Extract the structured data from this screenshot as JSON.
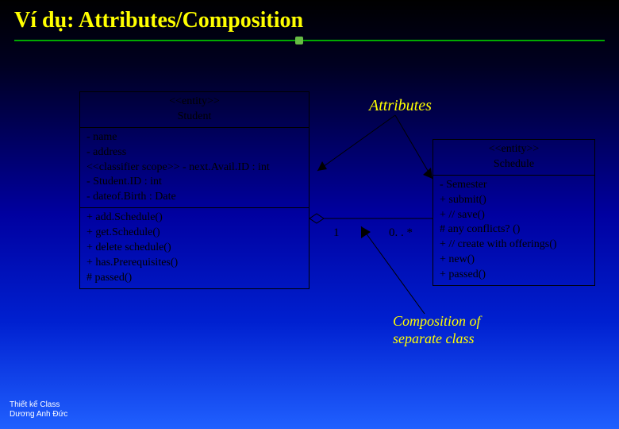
{
  "title": "Ví dụ: Attributes/Composition",
  "labels": {
    "attributes": "Attributes",
    "composition": "Composition of\nseparate class"
  },
  "student": {
    "stereotype": "<<entity>>",
    "name": "Student",
    "attrs": [
      "- name",
      "- address",
      "<<classifier scope>> - next.Avail.ID : int",
      "- Student.ID : int",
      "- dateof.Birth : Date"
    ],
    "ops": [
      "+ add.Schedule()",
      "+ get.Schedule()",
      "+ delete schedule()",
      "+ has.Prerequisites()",
      "# passed()"
    ]
  },
  "schedule": {
    "stereotype": "<<entity>>",
    "name": "Schedule",
    "members": [
      "- Semester",
      "+ submit()",
      "+ // save()",
      "# any conflicts? ()",
      "+ // create with offerings()",
      "+ new()",
      "+ passed()"
    ]
  },
  "multiplicity": {
    "left": "1",
    "right": "0. . *"
  },
  "footer": {
    "line1": "Thiết kế Class",
    "line2": "Dương Anh Đức"
  }
}
